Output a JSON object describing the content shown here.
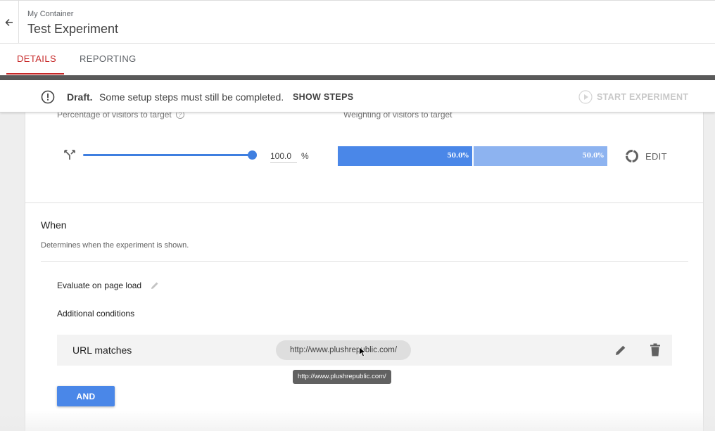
{
  "header": {
    "container_name": "My Container",
    "experiment_title": "Test Experiment"
  },
  "tabs": [
    {
      "label": "DETAILS",
      "active": true
    },
    {
      "label": "REPORTING",
      "active": false
    }
  ],
  "status": {
    "draft_label": "Draft.",
    "message": "Some setup steps must still be completed.",
    "show_steps_label": "SHOW STEPS",
    "start_label": "START EXPERIMENT"
  },
  "targeting": {
    "percentage_label": "Percentage of visitors to target",
    "percentage_value": "100.0",
    "percentage_unit": "%",
    "weighting_label": "Weighting of visitors to target",
    "weights": [
      "50.0%",
      "50.0%"
    ],
    "edit_label": "EDIT"
  },
  "when": {
    "title": "When",
    "description": "Determines when the experiment is shown.",
    "evaluate_prefix": "Evaluate on",
    "evaluate_value": "page load",
    "additional_conditions_label": "Additional conditions",
    "condition": {
      "label": "URL matches",
      "value": "http://www.plushrepublic.com/",
      "tooltip": "http://www.plushrepublic.com/"
    },
    "and_button_label": "AND"
  },
  "colors": {
    "accent_red": "#c62828",
    "primary_blue": "#4a87e8",
    "light_blue": "#8db3f0"
  }
}
